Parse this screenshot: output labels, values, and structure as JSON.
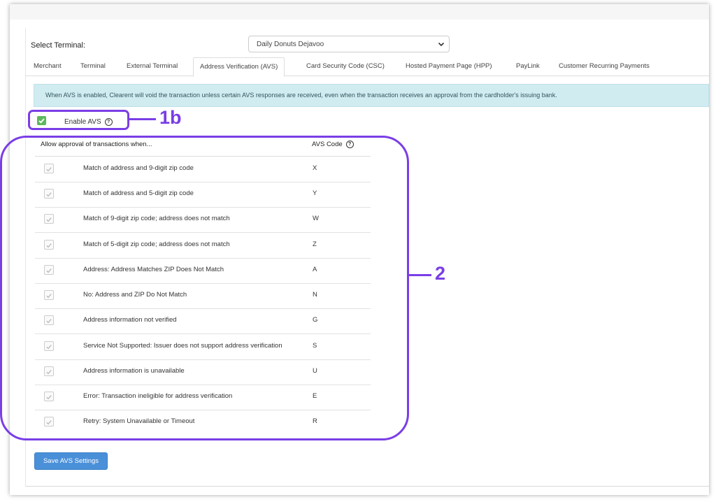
{
  "terminal": {
    "label": "Select Terminal:",
    "selected": "Daily Donuts Dejavoo"
  },
  "tabs": [
    {
      "label": "Merchant"
    },
    {
      "label": "Terminal"
    },
    {
      "label": "External Terminal"
    },
    {
      "label": "Address Verification (AVS)",
      "active": true
    },
    {
      "label": "Card Security Code (CSC)"
    },
    {
      "label": "Hosted Payment Page (HPP)"
    },
    {
      "label": "PayLink"
    },
    {
      "label": "Customer Recurring Payments"
    }
  ],
  "alert": "When AVS is enabled, Clearent will void the transaction unless certain AVS responses are received, even when the transaction receives an approval from the cardholder's issuing bank.",
  "enable": {
    "label": "Enable AVS",
    "checked": true
  },
  "table": {
    "col_desc": "Allow approval of transactions when...",
    "col_code": "AVS Code",
    "rows": [
      {
        "desc": "Match of address and 9-digit zip code",
        "code": "X"
      },
      {
        "desc": "Match of address and 5-digit zip code",
        "code": "Y"
      },
      {
        "desc": "Match of 9-digit zip code; address does not match",
        "code": "W"
      },
      {
        "desc": "Match of 5-digit zip code; address does not match",
        "code": "Z"
      },
      {
        "desc": "Address: Address Matches ZIP Does Not Match",
        "code": "A"
      },
      {
        "desc": "No: Address and ZIP Do Not Match",
        "code": "N"
      },
      {
        "desc": "Address information not verified",
        "code": "G"
      },
      {
        "desc": "Service Not Supported: Issuer does not support address verification",
        "code": "S"
      },
      {
        "desc": "Address information is unavailable",
        "code": "U"
      },
      {
        "desc": "Error: Transaction ineligible for address verification",
        "code": "E"
      },
      {
        "desc": "Retry: System Unavailable or Timeout",
        "code": "R"
      }
    ]
  },
  "save_label": "Save AVS Settings",
  "annotations": {
    "label_1": "1b",
    "label_2": "2",
    "color": "#7a3ee6"
  }
}
